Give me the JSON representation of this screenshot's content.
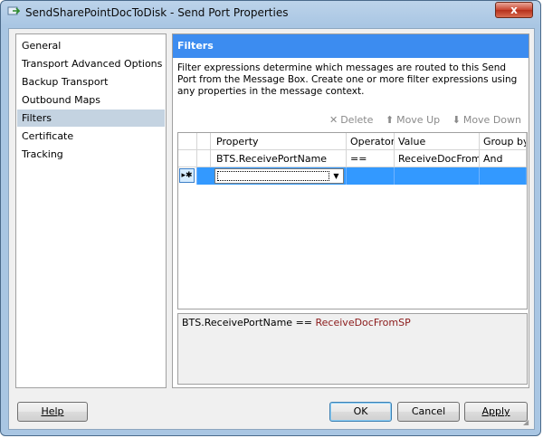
{
  "window": {
    "title": "SendSharePointDocToDisk - Send Port Properties",
    "close_glyph": "x"
  },
  "nav": {
    "items": [
      {
        "label": "General"
      },
      {
        "label": "Transport Advanced Options"
      },
      {
        "label": "Backup Transport"
      },
      {
        "label": "Outbound Maps"
      },
      {
        "label": "Filters",
        "selected": true
      },
      {
        "label": "Certificate"
      },
      {
        "label": "Tracking"
      }
    ]
  },
  "panel": {
    "title": "Filters",
    "description": "Filter expressions determine which messages are routed to this Send Port from the Message Box. Create one or more filter expressions using any properties in the message context."
  },
  "toolbar": {
    "delete_label": "Delete",
    "move_up_label": "Move Up",
    "move_down_label": "Move Down"
  },
  "grid": {
    "columns": [
      "Property",
      "Operator",
      "Value",
      "Group by"
    ],
    "rows": [
      {
        "property": "BTS.ReceivePortName",
        "operator": "==",
        "value": "ReceiveDocFrom...",
        "group_by": "And"
      }
    ],
    "new_row_marker": "▸✱"
  },
  "expression": {
    "left": "BTS.ReceivePortName",
    "operator": "==",
    "right": "ReceiveDocFromSP"
  },
  "buttons": {
    "help": "Help",
    "ok": "OK",
    "cancel": "Cancel",
    "apply": "Apply"
  },
  "colors": {
    "header_blue": "#3c8cf0",
    "selection_blue": "#3399ff",
    "expression_value": "#8b1a1a"
  }
}
